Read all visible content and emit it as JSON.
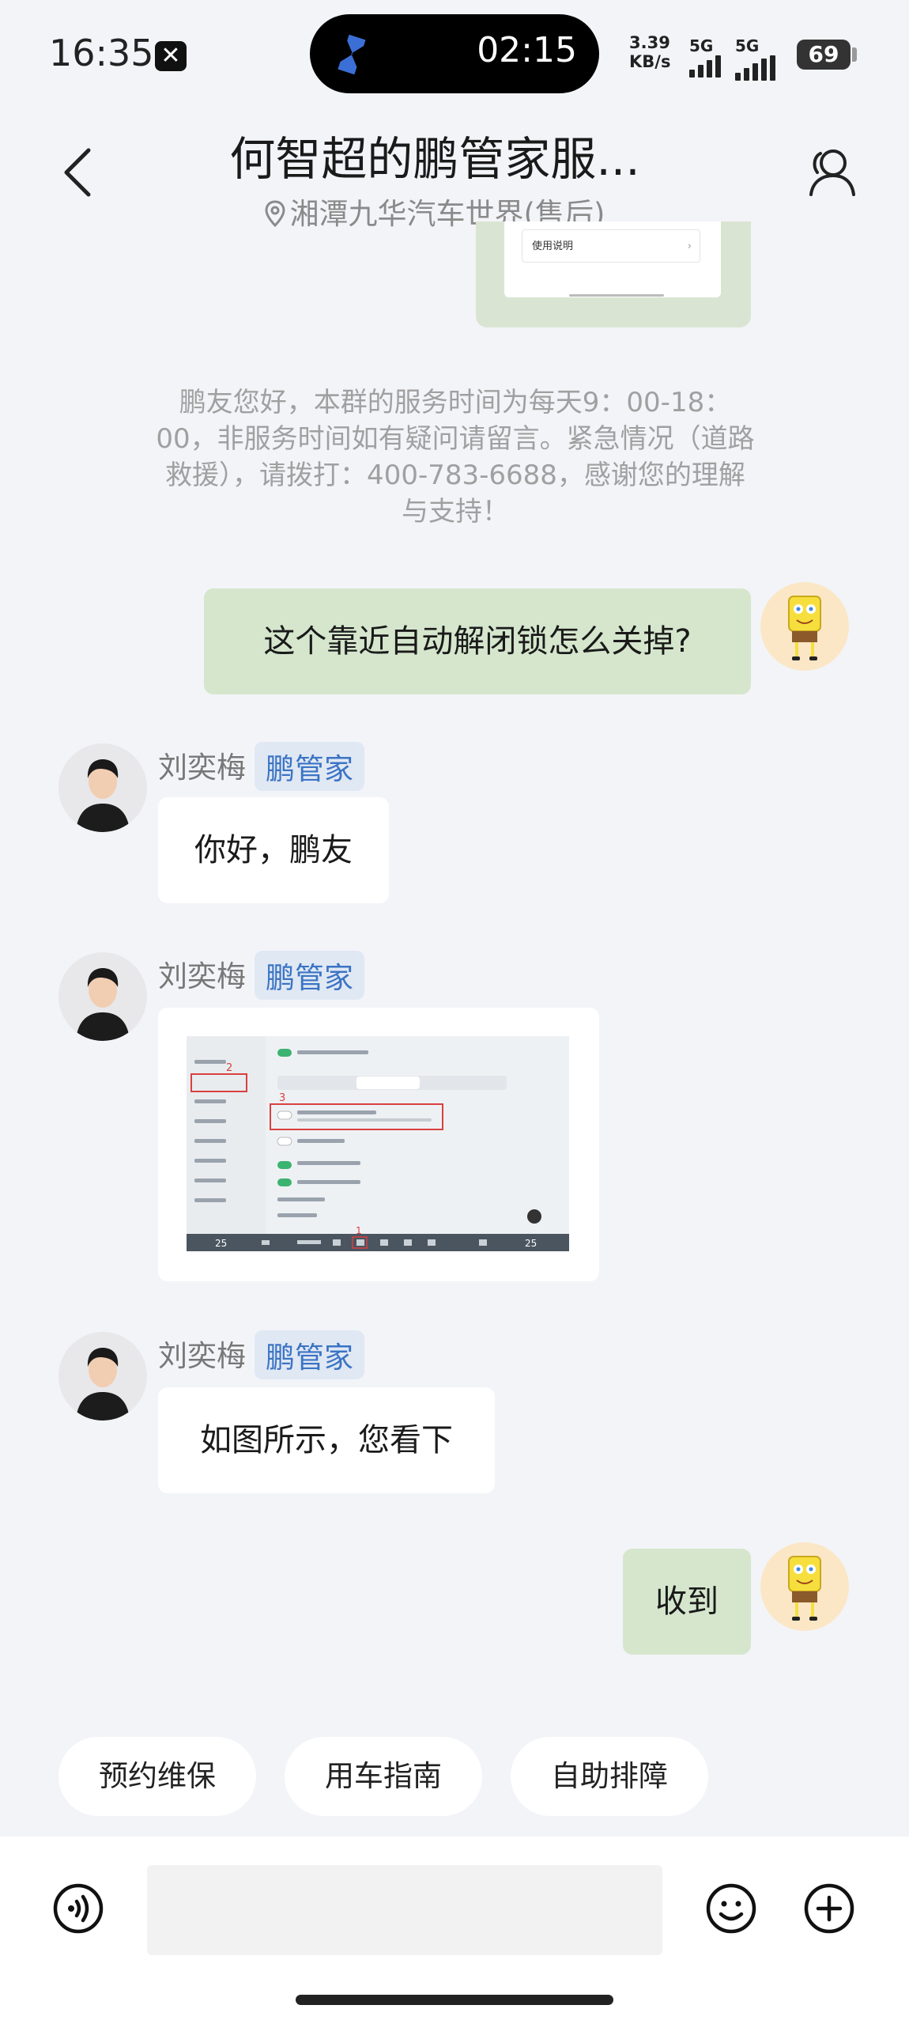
{
  "status_bar": {
    "time": "16:35",
    "notification_icon": "x-app-icon",
    "timer": "02:15",
    "net_speed_value": "3.39",
    "net_speed_unit": "KB/s",
    "signal_1": "5G",
    "signal_2": "5G",
    "battery": "69"
  },
  "header": {
    "title": "何智超的鹏管家服...",
    "subtitle": "湘潭九华汽车世界(售后)",
    "back_icon": "chevron-left-icon",
    "contact_icon": "person-icon"
  },
  "top_card": {
    "row_label": "使用说明"
  },
  "notice": "鹏友您好，本群的服务时间为每天9：00-18：00，非服务时间如有疑问请留言。紧急情况（道路救援），请拨打：400-783-6688，感谢您的理解与支持！",
  "messages": [
    {
      "side": "right",
      "text": "这个靠近自动解闭锁怎么关掉?"
    },
    {
      "side": "left",
      "sender": "刘奕梅",
      "tag": "鹏管家",
      "text": "你好，鹏友"
    },
    {
      "side": "left",
      "sender": "刘奕梅",
      "tag": "鹏管家",
      "type": "image"
    },
    {
      "side": "left",
      "sender": "刘奕梅",
      "tag": "鹏管家",
      "text": "如图所示，您看下"
    },
    {
      "side": "right",
      "text": "收到"
    }
  ],
  "screenshot": {
    "markers": [
      "1",
      "2",
      "3"
    ],
    "temp_left": "25",
    "temp_right": "25"
  },
  "quick_actions": [
    "预约维保",
    "用车指南",
    "自助排障"
  ],
  "colors": {
    "background": "#f3f4f8",
    "bubble_sent": "#d5e6cd",
    "bubble_received": "#ffffff",
    "tag_text": "#3b74c4",
    "tag_bg": "#e0e8f4"
  }
}
